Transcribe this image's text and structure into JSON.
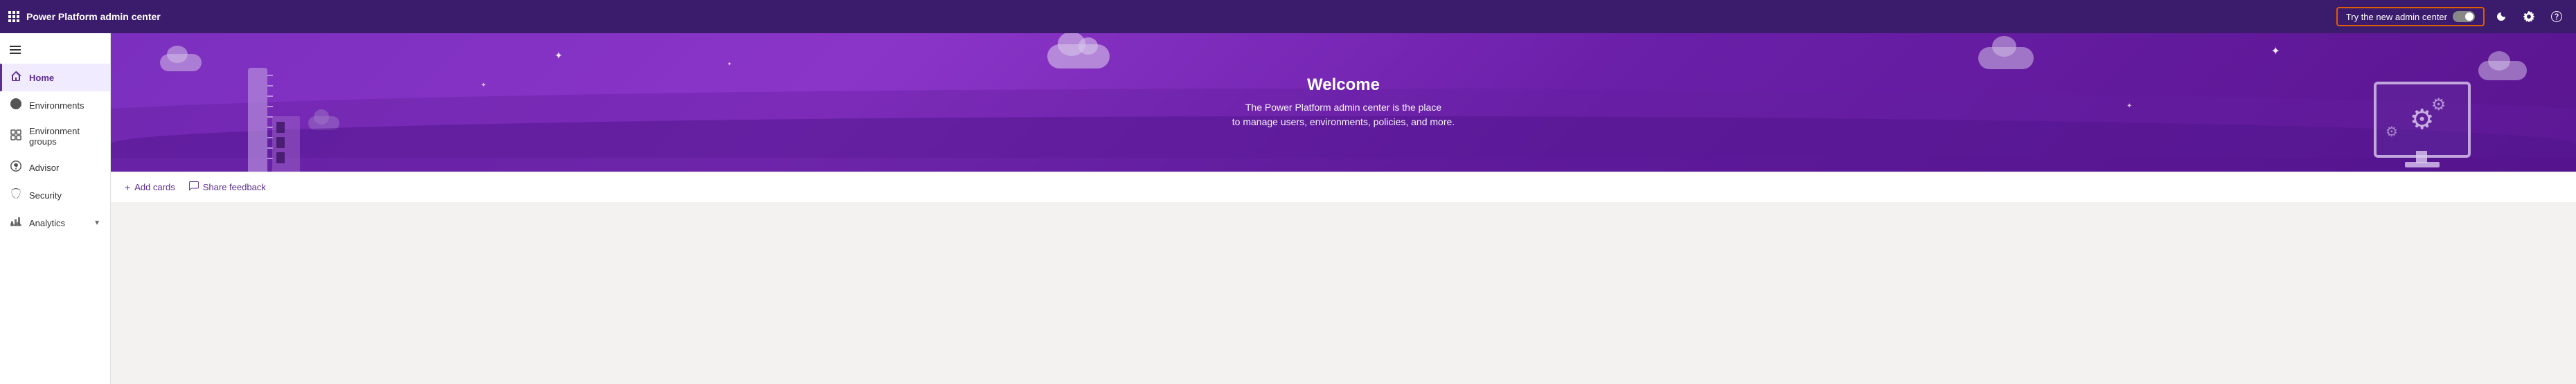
{
  "app": {
    "title": "Power Platform admin center"
  },
  "topbar": {
    "try_new_label": "Try the new admin center",
    "icons": {
      "waffle": "⊞",
      "moon": "☽",
      "settings": "⚙",
      "help": "?"
    }
  },
  "sidebar": {
    "hamburger_label": "≡",
    "items": [
      {
        "id": "home",
        "label": "Home",
        "icon": "🏠",
        "active": true
      },
      {
        "id": "environments",
        "label": "Environments",
        "icon": "🌐",
        "active": false
      },
      {
        "id": "environment-groups",
        "label": "Environment groups",
        "icon": "🗂",
        "active": false
      },
      {
        "id": "advisor",
        "label": "Advisor",
        "icon": "📡",
        "active": false
      },
      {
        "id": "security",
        "label": "Security",
        "icon": "🔒",
        "active": false
      },
      {
        "id": "analytics",
        "label": "Analytics",
        "icon": "📊",
        "active": false,
        "has_chevron": true
      }
    ]
  },
  "hero": {
    "title": "Welcome",
    "subtitle_line1": "The Power Platform admin center is the place",
    "subtitle_line2": "to manage users, environments, policies, and more."
  },
  "bottom_actions": [
    {
      "id": "add-cards",
      "label": "Add cards",
      "icon": "+"
    },
    {
      "id": "share-feedback",
      "label": "Share feedback",
      "icon": "💬"
    }
  ]
}
